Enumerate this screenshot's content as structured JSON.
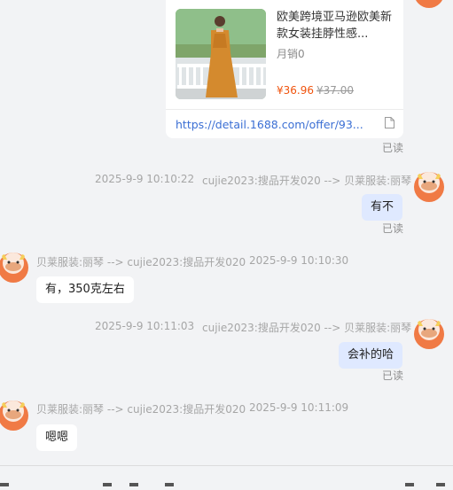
{
  "product_card": {
    "title": "欧美跨境亚马逊欧美新款女装挂脖性感...",
    "sales": "月销0",
    "price": "¥36.96",
    "original_price": "¥37.00",
    "link": "https://detail.1688.com/offer/93..."
  },
  "messages": [
    {
      "read": "已读"
    },
    {
      "timestamp": "2025-9-9 10:10:22",
      "route": "cujie2023:搜品开发020 --> 贝莱服装:丽琴",
      "text": "有不",
      "read": "已读"
    },
    {
      "route": "贝莱服装:丽琴 --> cujie2023:搜品开发020",
      "timestamp": "2025-9-9 10:10:30",
      "text": "有，350克左右"
    },
    {
      "timestamp": "2025-9-9 10:11:03",
      "route": "cujie2023:搜品开发020 --> 贝莱服装:丽琴",
      "text": "会补的哈",
      "read": "已读"
    },
    {
      "route": "贝莱服装:丽琴 --> cujie2023:搜品开发020",
      "timestamp": "2025-9-9 10:11:09",
      "text": "嗯嗯"
    }
  ],
  "colors": {
    "background": "#f2f3f5",
    "self_bubble": "#dfe9ff",
    "peer_bubble": "#ffffff",
    "price": "#f0530d",
    "link": "#3b6fd4",
    "avatar": "#f07a45"
  }
}
